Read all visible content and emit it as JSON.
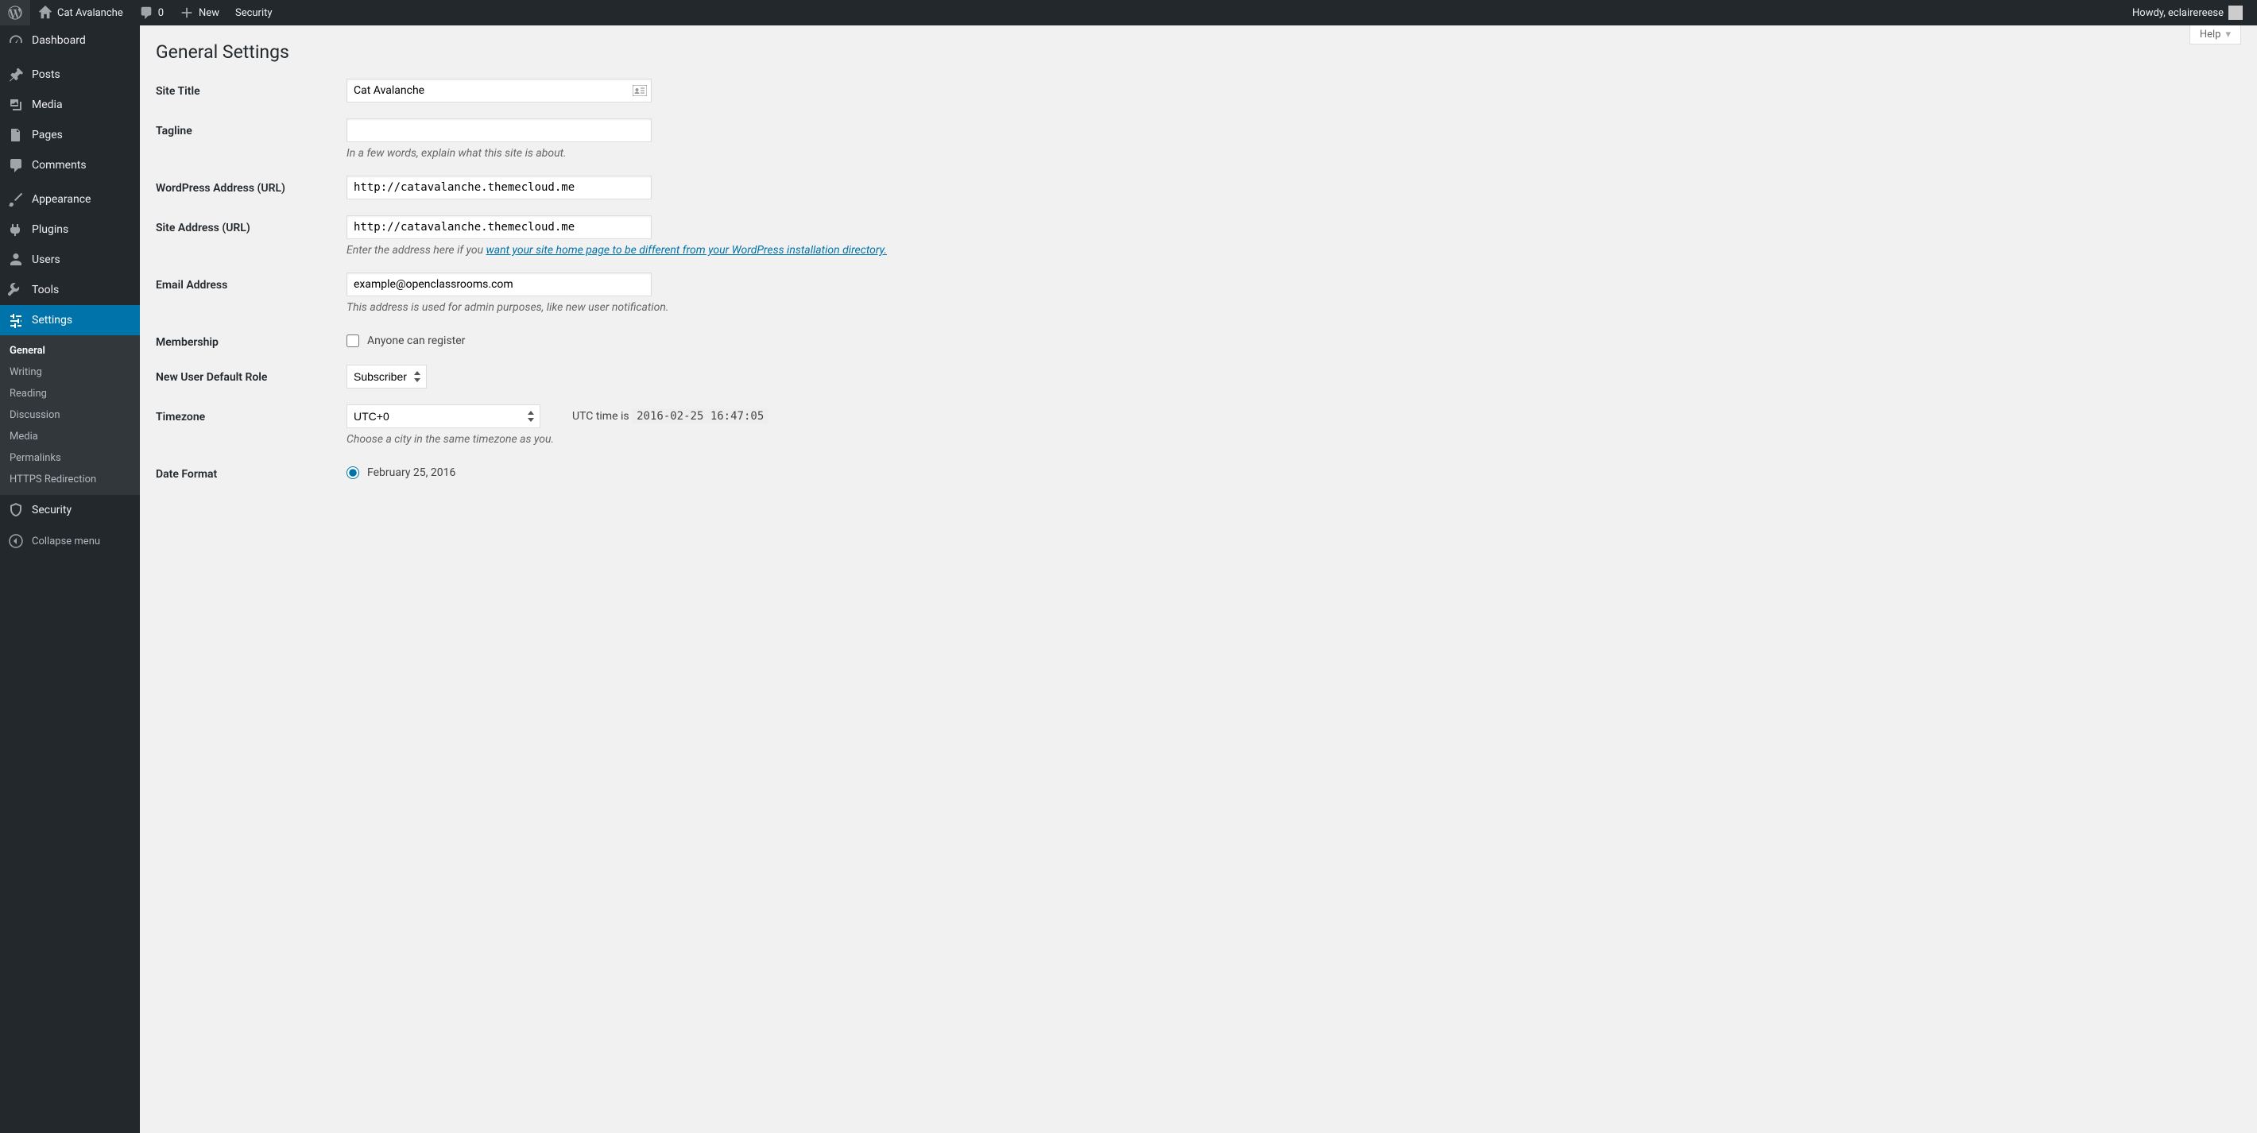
{
  "adminbar": {
    "site_name": "Cat Avalanche",
    "comments_count": "0",
    "new_label": "New",
    "security_label": "Security",
    "howdy": "Howdy, eclairereese"
  },
  "sidebar": {
    "items": [
      {
        "label": "Dashboard"
      },
      {
        "label": "Posts"
      },
      {
        "label": "Media"
      },
      {
        "label": "Pages"
      },
      {
        "label": "Comments"
      },
      {
        "label": "Appearance"
      },
      {
        "label": "Plugins"
      },
      {
        "label": "Users"
      },
      {
        "label": "Tools"
      },
      {
        "label": "Settings"
      },
      {
        "label": "Security"
      }
    ],
    "submenu": [
      {
        "label": "General"
      },
      {
        "label": "Writing"
      },
      {
        "label": "Reading"
      },
      {
        "label": "Discussion"
      },
      {
        "label": "Media"
      },
      {
        "label": "Permalinks"
      },
      {
        "label": "HTTPS Redirection"
      }
    ],
    "collapse": "Collapse menu"
  },
  "help_label": "Help",
  "page_title": "General Settings",
  "fields": {
    "site_title": {
      "label": "Site Title",
      "value": "Cat Avalanche"
    },
    "tagline": {
      "label": "Tagline",
      "value": "",
      "desc": "In a few words, explain what this site is about."
    },
    "wp_url": {
      "label": "WordPress Address (URL)",
      "value": "http://catavalanche.themecloud.me"
    },
    "site_url": {
      "label": "Site Address (URL)",
      "value": "http://catavalanche.themecloud.me",
      "desc_pre": "Enter the address here if you ",
      "desc_link": "want your site home page to be different from your WordPress installation directory."
    },
    "email": {
      "label": "Email Address",
      "value": "example@openclassrooms.com",
      "desc": "This address is used for admin purposes, like new user notification."
    },
    "membership": {
      "label": "Membership",
      "checkbox_label": "Anyone can register"
    },
    "default_role": {
      "label": "New User Default Role",
      "value": "Subscriber"
    },
    "timezone": {
      "label": "Timezone",
      "value": "UTC+0",
      "utc_label": "UTC time is",
      "utc_time": "2016-02-25 16:47:05",
      "desc": "Choose a city in the same timezone as you."
    },
    "date_format": {
      "label": "Date Format",
      "option1": "February 25, 2016"
    }
  }
}
